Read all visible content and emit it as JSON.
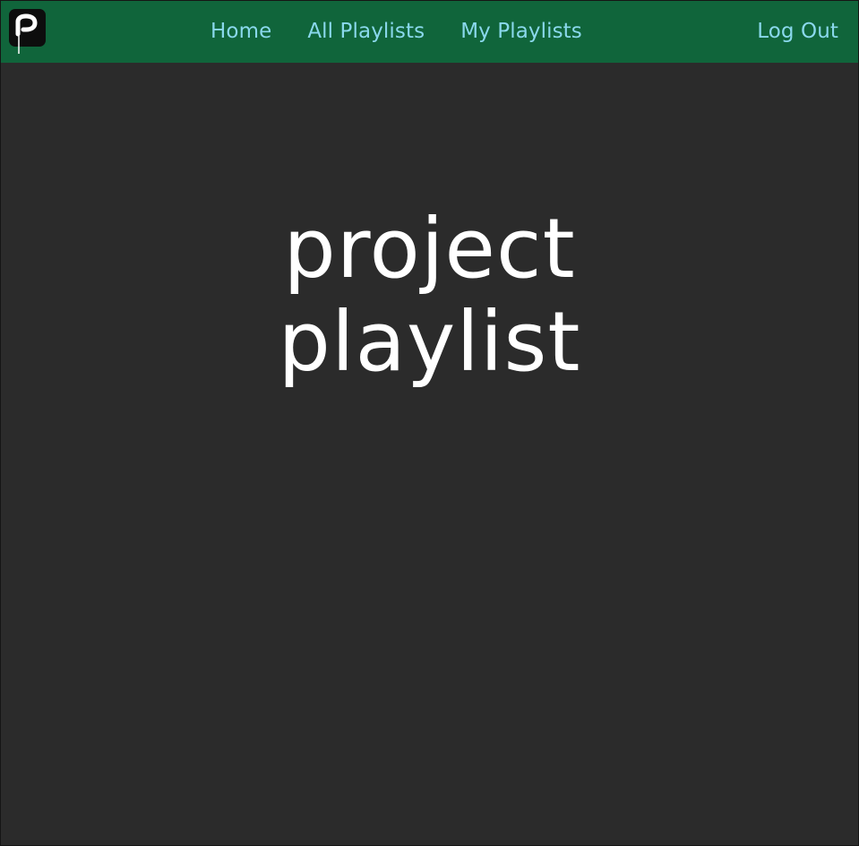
{
  "app": {
    "title": "project playlist"
  },
  "nav": {
    "logo_icon": "music-note-logo",
    "home_label": "Home",
    "all_playlists_label": "All Playlists",
    "my_playlists_label": "My Playlists",
    "logout_label": "Log Out"
  },
  "hero": {
    "line1": "project",
    "line2": "playlist"
  },
  "colors": {
    "navbar": "#10653b",
    "background": "#2b2b2b",
    "nav_link": "#8ad8ec",
    "hero_text": "#ffffff"
  }
}
